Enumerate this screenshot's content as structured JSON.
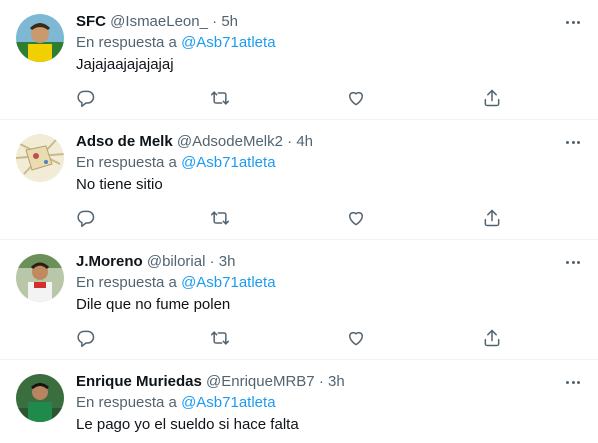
{
  "reply_prefix": "En respuesta a",
  "tweets": [
    {
      "name": "SFC",
      "handle": "@IsmaeLeon_",
      "separator": "·",
      "time": "5h",
      "mention": "@Asb71atleta",
      "text": "Jajajaajajajajaj"
    },
    {
      "name": "Adso de Melk",
      "handle": "@AdsodeMelk2",
      "separator": "·",
      "time": "4h",
      "mention": "@Asb71atleta",
      "text": "No tiene sitio"
    },
    {
      "name": "J.Moreno",
      "handle": "@bilorial",
      "separator": "·",
      "time": "3h",
      "mention": "@Asb71atleta",
      "text": "Dile que no fume polen"
    },
    {
      "name": "Enrique Muriedas",
      "handle": "@EnriqueMRB7",
      "separator": "·",
      "time": "3h",
      "mention": "@Asb71atleta",
      "text": "Le pago yo el sueldo si hace falta"
    }
  ],
  "icons": {
    "more": "more-icon",
    "reply": "reply-icon",
    "retweet": "retweet-icon",
    "like": "like-icon",
    "share": "share-icon"
  },
  "colors": {
    "link": "#1d9bf0",
    "secondary_text": "#536471",
    "primary_text": "#0f1419",
    "divider": "#eff3f4"
  }
}
